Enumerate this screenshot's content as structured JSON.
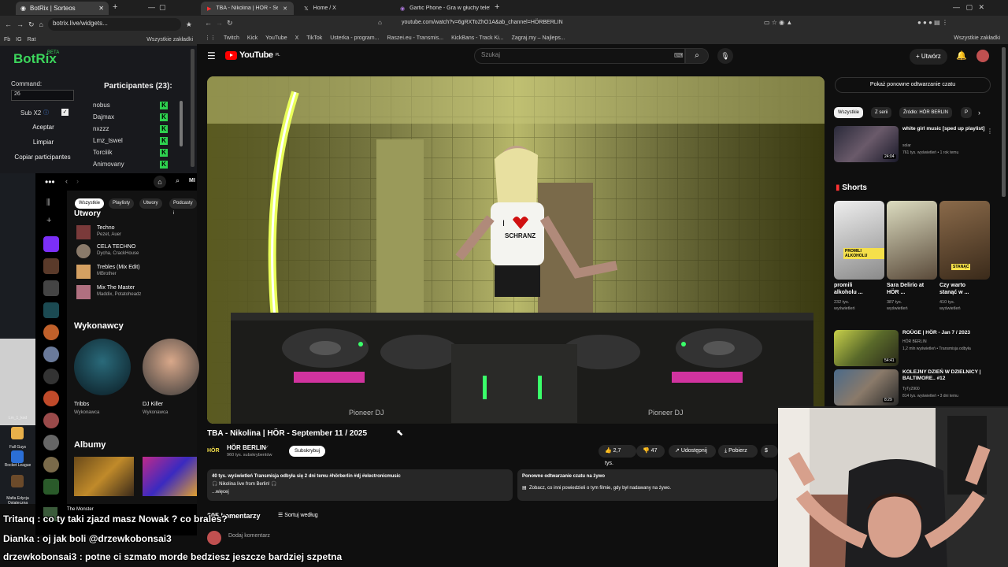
{
  "left_browser": {
    "tabs": [
      {
        "label": "BotRix | Sorteos"
      }
    ],
    "url": "botrix.live/widgets...",
    "bookmarks": [
      "Fb",
      "IG",
      "Rat",
      "Wszystkie zakładki"
    ]
  },
  "botrix": {
    "logo": "BotRix",
    "badge": "BETA",
    "command_label": "Command:",
    "command_value": "26",
    "sub_label": "Sub X2",
    "accept": "Aceptar",
    "clear": "Limpiar",
    "copy": "Copiar participantes",
    "participants_title": "Participantes (23):",
    "participants": [
      "nobus",
      "Dajmax",
      "nxzzz",
      "Lmz_tswel",
      "Torciiik",
      "Animovany"
    ],
    "kick_glyph": "K"
  },
  "spotify": {
    "chips": [
      "Wszystkie",
      "Playlisty",
      "Utwory",
      "Podcasty i"
    ],
    "search_label": "MI",
    "songs_header": "Utwory",
    "songs": [
      {
        "title": "Techno",
        "artist": "Pezet, Auer"
      },
      {
        "title": "CELA TECHNO",
        "artist": "Dycha, CrackHouse"
      },
      {
        "title": "Trebles (Mix Edit)",
        "artist": "MBrother"
      },
      {
        "title": "Mix The Master",
        "artist": "Maddix, Potatoheadz"
      }
    ],
    "artists_header": "Wykonawcy",
    "artists": [
      {
        "name": "Tribbs",
        "role": "Wykonawca"
      },
      {
        "name": "DJ Killer",
        "role": "Wykonawca"
      }
    ],
    "albums_header": "Albumy",
    "now_playing": "The Monster"
  },
  "desktop": {
    "labels": [
      "Lm_1_kod",
      "Fall Guys",
      "Rocket League",
      "Mafia Edycja Ostateczna"
    ]
  },
  "chat": [
    {
      "text": "Tritanq : co ty taki zjazd masz Nowak ? co brales?"
    },
    {
      "text": "Dianka : oj jak boli @drzewkobonsai3"
    },
    {
      "text": "drzewkobonsai3 : potne ci szmato morde bedziesz jeszcze bardziej szpetna"
    }
  ],
  "right_browser": {
    "tabs": [
      {
        "label": "TBA - Nikolina | HÖR - Septe"
      },
      {
        "label": "Home / X"
      },
      {
        "label": "Gartic Phone - Gra w głuchy telefon"
      }
    ],
    "url": "youtube.com/watch?v=6gRXToZhO1A&ab_channel=HÖRBERLIN",
    "bookmarks": [
      "Twitch",
      "Kick",
      "YouTube",
      "X",
      "TikTok",
      "Usterka - program...",
      "Raszei.eu - Transmis...",
      "KickBans - Track Ki...",
      "Zagraj.my – Najleps...",
      "Wszystkie zakładki"
    ]
  },
  "youtube": {
    "logo": "YouTube",
    "region": "PL",
    "search_placeholder": "Szukaj",
    "create": "Utwórz",
    "video_title": "TBA - Nikolina | HÖR - September 11 / 2025",
    "channel": "HÖR BERLIN",
    "channel_badge": "HÖR",
    "subscribers": "960 tys. subskrybentów",
    "subscribe": "Subskrybuj",
    "likes": "2,7 tys.",
    "dislikes": "47",
    "share": "Udostępnij",
    "download": "Pobierz",
    "description_meta": "40 tys. wyświetleń  Transmisja odbyła się 2 dni temu  #hörberlin #dj #electronicmusic",
    "description_text": "🎧 Nikolina live from Berlin! 🎧",
    "description_more": "...więcej",
    "live_title": "Ponowne odtwarzanie czatu na żywo",
    "live_text": "Zobacz, co inni powiedzieli o tym filmie, gdy był nadawany na żywo.",
    "comments_count": "205 komentarzy",
    "sort": "Sortuj według",
    "add_comment": "Dodaj komentarz",
    "replay_chat": "Pokaż ponowne odtwarzanie czatu",
    "chips": [
      "Wszystkie",
      "Z serii",
      "Źródło: HÖR BERLIN",
      "P"
    ],
    "recs": [
      {
        "title": "white girl music [sped up playlist]",
        "channel": "solar",
        "meta": "761 tys. wyświetleń • 1 rok temu",
        "duration": "24:04"
      },
      {
        "title": "ROÜGE | HÖR - Jan 7 / 2023",
        "channel": "HÖR BERLIN",
        "meta": "1,2 mln wyświetleń • Transmisja odbyła",
        "duration": "54:41"
      },
      {
        "title": "KOLEJNY DZIEŃ W DZIELNICY | BALTIMORE.. #12",
        "channel": "TyTy2900",
        "meta": "814 tys. wyświetleń • 3 dni temu",
        "duration": "8:29"
      }
    ],
    "shorts_header": "Shorts",
    "shorts": [
      {
        "title": "promili alkoholu ...",
        "views": "232 tys. wyświetleń"
      },
      {
        "title": "Sara Delirio at HÖR ...",
        "views": "387 tys. wyświetleń"
      },
      {
        "title": "Czy warto stanąć w ...",
        "views": "410 tys. wyświetleń"
      }
    ],
    "shorts_overlay": [
      "PROMILI ALKOHOLU",
      "STANĄĆ"
    ]
  },
  "video_overlay": {
    "shirt_line1": "I",
    "shirt_line2": "SCHRANZ",
    "brand": "Pioneer DJ"
  }
}
